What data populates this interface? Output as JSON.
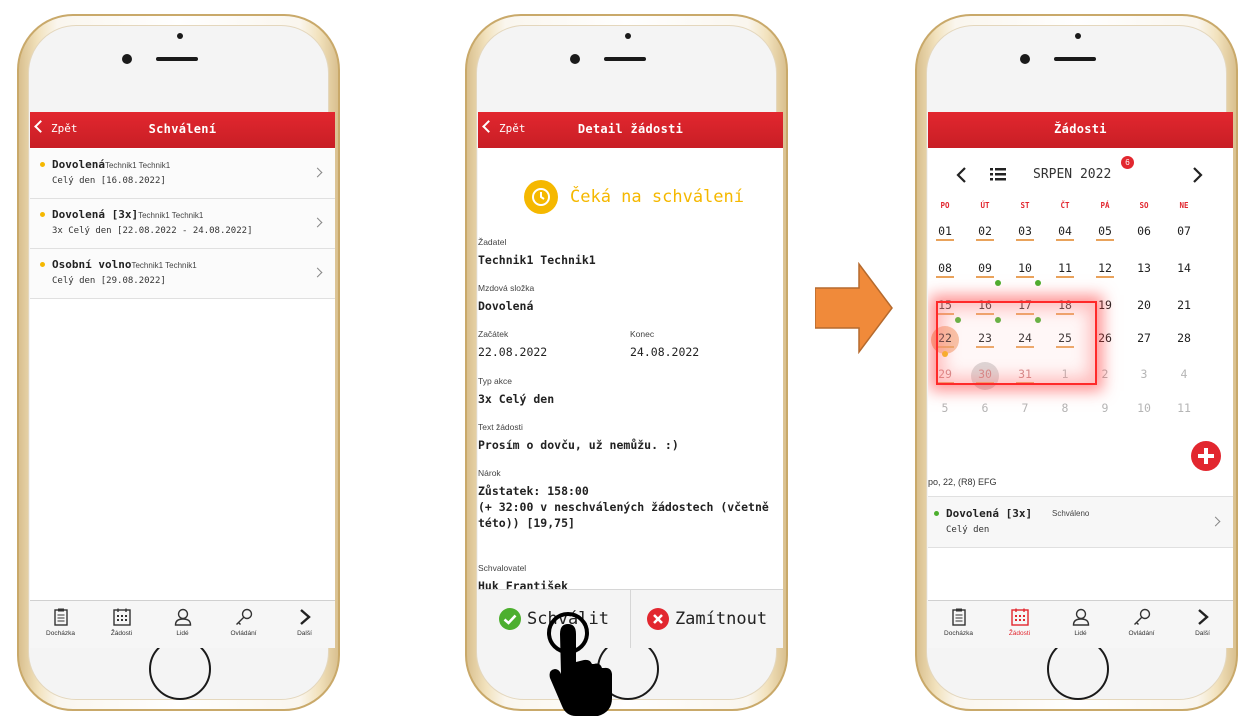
{
  "screen1": {
    "header": {
      "back_label": "Zpět",
      "title": "Schválení"
    },
    "items": [
      {
        "title": "Dovolená",
        "person": "Technik1 Technik1",
        "detail": "Celý den [16.08.2022]"
      },
      {
        "title": "Dovolená [3x]",
        "person": "Technik1 Technik1",
        "detail": "3x Celý den [22.08.2022 - 24.08.2022]"
      },
      {
        "title": "Osobní volno",
        "person": "Technik1 Technik1",
        "detail": "Celý den [29.08.2022]"
      }
    ]
  },
  "screen2": {
    "header": {
      "back_label": "Zpět",
      "title": "Detail žádosti"
    },
    "status": "Čeká na schválení",
    "fields": {
      "requester_label": "Žadatel",
      "requester": "Technik1 Technik1",
      "wage_label": "Mzdová složka",
      "wage": "Dovolená",
      "start_label": "Začátek",
      "start": "22.08.2022",
      "end_label": "Konec",
      "end": "24.08.2022",
      "action_label": "Typ akce",
      "action": "3x Celý den",
      "text_label": "Text žádosti",
      "text": "Prosím o dovču, už nemůžu. :)",
      "claim_label": "Nárok",
      "claim_line1": "Zůstatek: 158:00",
      "claim_line2": "(+ 32:00 v neschválených žádostech (včetně",
      "claim_line3": "této)) [19,75]",
      "approver_label": "Schvalovatel",
      "approver": "Huk František"
    },
    "approve_label": "Schválit",
    "reject_label": "Zamítnout"
  },
  "screen3": {
    "header": {
      "title": "Žádosti"
    },
    "month": "SRPEN 2022",
    "badge": "6",
    "weekdays": [
      "PO",
      "ÚT",
      "ST",
      "ČT",
      "PÁ",
      "SO",
      "NE"
    ],
    "weeks": [
      [
        "01",
        "02",
        "03",
        "04",
        "05",
        "06",
        "07"
      ],
      [
        "08",
        "09",
        "10",
        "11",
        "12",
        "13",
        "14"
      ],
      [
        "15",
        "16",
        "17",
        "18",
        "19",
        "20",
        "21"
      ],
      [
        "22",
        "23",
        "24",
        "25",
        "26",
        "27",
        "28"
      ],
      [
        "29",
        "30",
        "31",
        "1",
        "2",
        "3",
        "4"
      ],
      [
        "5",
        "6",
        "7",
        "8",
        "9",
        "10",
        "11"
      ]
    ],
    "selected_info": "po, 22, (R8) EFG",
    "event": {
      "title": "Dovolená [3x]",
      "status": "Schváleno",
      "detail": "Celý den"
    }
  },
  "tabbar": [
    "Docházka",
    "Žádosti",
    "Lidé",
    "Ovládání",
    "Další"
  ],
  "colors": {
    "brand_red": "#e2272f",
    "pending_yellow": "#f5b800",
    "approved_green": "#4caf2e",
    "highlight_red": "#ff2a2a",
    "arrow_orange": "#f08a3a"
  }
}
